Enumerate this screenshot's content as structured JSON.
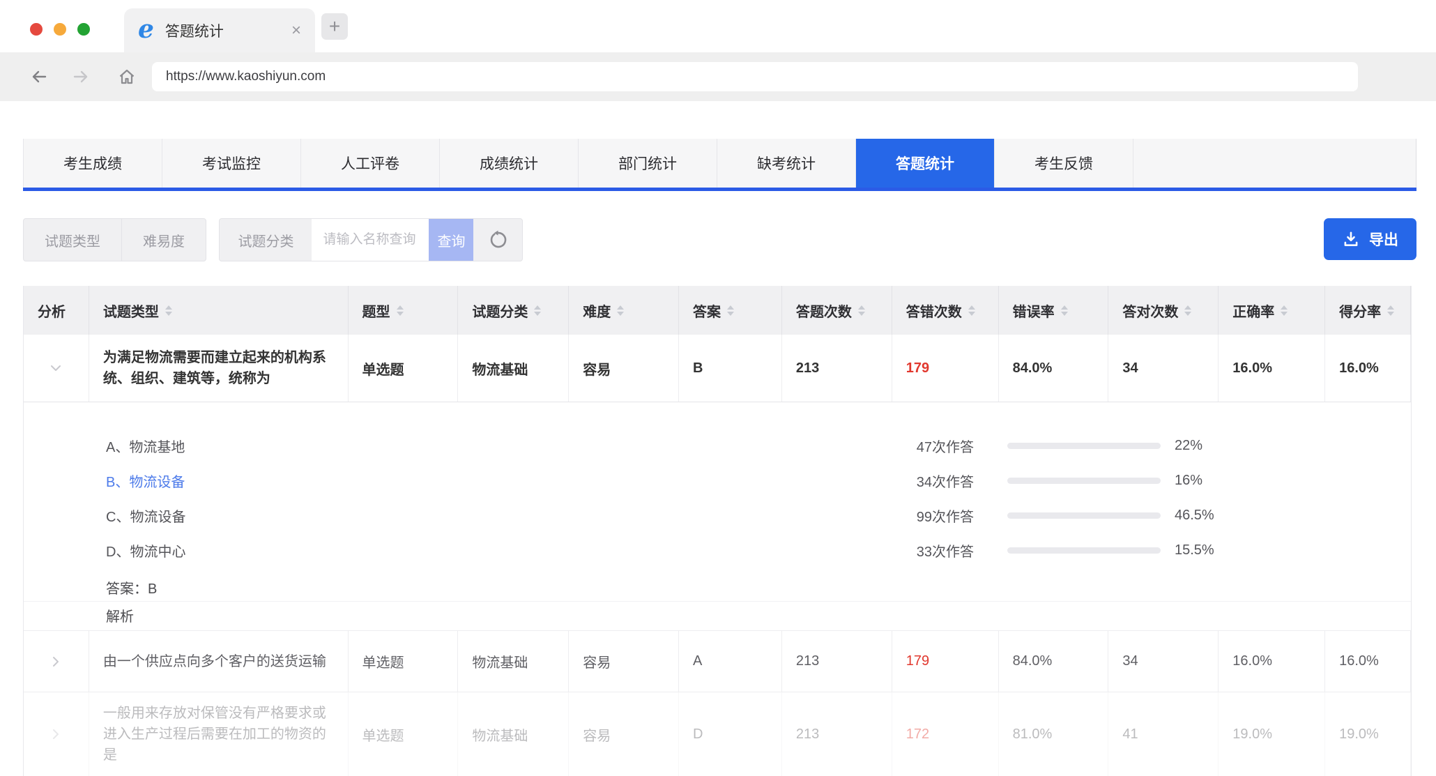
{
  "browser": {
    "tab_title": "答题统计",
    "close_glyph": "×",
    "new_tab_glyph": "+",
    "logo_glyph": "e",
    "url": "https://www.kaoshiyun.com"
  },
  "nav": {
    "tabs": [
      {
        "label": "考生成绩"
      },
      {
        "label": "考试监控"
      },
      {
        "label": "人工评卷"
      },
      {
        "label": "成绩统计"
      },
      {
        "label": "部门统计"
      },
      {
        "label": "缺考统计"
      },
      {
        "label": "答题统计",
        "active": true
      },
      {
        "label": "考生反馈"
      }
    ]
  },
  "filters": {
    "type_button": "试题类型",
    "difficulty_button": "难易度",
    "category_label": "试题分类",
    "search_placeholder": "请输入名称查询",
    "query_button": "查询",
    "export_button": "导出"
  },
  "table": {
    "columns": [
      {
        "label": "分析",
        "sortable": false
      },
      {
        "label": "试题类型",
        "sortable": true
      },
      {
        "label": "题型",
        "sortable": true
      },
      {
        "label": "试题分类",
        "sortable": true
      },
      {
        "label": "难度",
        "sortable": true
      },
      {
        "label": "答案",
        "sortable": true
      },
      {
        "label": "答题次数",
        "sortable": true
      },
      {
        "label": "答错次数",
        "sortable": true
      },
      {
        "label": "错误率",
        "sortable": true
      },
      {
        "label": "答对次数",
        "sortable": true
      },
      {
        "label": "正确率",
        "sortable": true
      },
      {
        "label": "得分率",
        "sortable": true
      }
    ],
    "rows": [
      {
        "question": "为满足物流需要而建立起来的机构系统、组织、建筑等，统称为",
        "type": "单选题",
        "category": "物流基础",
        "difficulty": "容易",
        "answer": "B",
        "attempts": "213",
        "wrong": "179",
        "wrong_rate": "84.0%",
        "right": "34",
        "right_rate": "16.0%",
        "score_rate": "16.0%"
      },
      {
        "question": "由一个供应点向多个客户的送货运输",
        "type": "单选题",
        "category": "物流基础",
        "difficulty": "容易",
        "answer": "A",
        "attempts": "213",
        "wrong": "179",
        "wrong_rate": "84.0%",
        "right": "34",
        "right_rate": "16.0%",
        "score_rate": "16.0%"
      },
      {
        "question": "一般用来存放对保管没有严格要求或进入生产过程后需要在加工的物资的是",
        "type": "单选题",
        "category": "物流基础",
        "difficulty": "容易",
        "answer": "D",
        "attempts": "213",
        "wrong": "172",
        "wrong_rate": "81.0%",
        "right": "41",
        "right_rate": "19.0%",
        "score_rate": "19.0%"
      }
    ],
    "detail": {
      "options": [
        {
          "text": "A、物流基地",
          "correct": false
        },
        {
          "text": "B、物流设备",
          "correct": true
        },
        {
          "text": "C、物流设备",
          "correct": false
        },
        {
          "text": "D、物流中心",
          "correct": false
        }
      ],
      "stats": [
        {
          "count": "47次作答",
          "pct": "22%",
          "fill": 37
        },
        {
          "count": "34次作答",
          "pct": "16%",
          "fill": 24.5
        },
        {
          "count": "99次作答",
          "pct": "46.5%",
          "fill": 57
        },
        {
          "count": "33次作答",
          "pct": "15.5%",
          "fill": 20
        }
      ],
      "answer_line": "答案：B",
      "analysis_label": "解析"
    }
  },
  "colors": {
    "primary_blue": "#2667e8",
    "underline_blue": "#2b5be6",
    "query_disabled_blue": "#a6b7f3",
    "bar_fill_blue": "#4d7cf0",
    "correct_option_blue": "#4d7bea",
    "error_red": "#e1382e"
  }
}
